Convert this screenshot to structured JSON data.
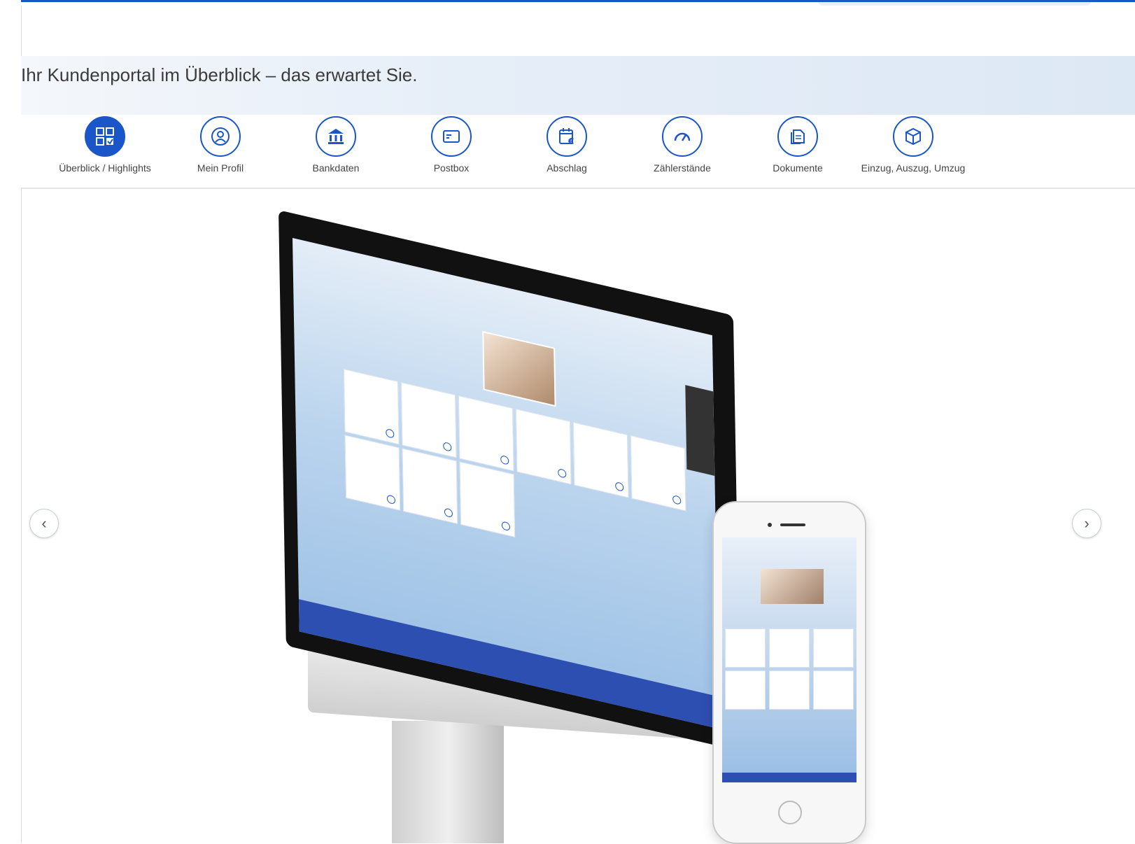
{
  "banner": {
    "title": "Ihr Kundenportal im Überblick – das erwartet Sie."
  },
  "nav": {
    "active_index": 0,
    "items": [
      {
        "label": "Überblick / Highlights",
        "icon": "overview-grid-icon"
      },
      {
        "label": "Mein Profil",
        "icon": "user-profile-icon"
      },
      {
        "label": "Bankdaten",
        "icon": "bank-icon"
      },
      {
        "label": "Postbox",
        "icon": "mailbox-icon"
      },
      {
        "label": "Abschlag",
        "icon": "calendar-euro-icon"
      },
      {
        "label": "Zählerstände",
        "icon": "gauge-icon"
      },
      {
        "label": "Dokumente",
        "icon": "documents-icon"
      },
      {
        "label": "Einzug, Auszug, Umzug",
        "icon": "move-box-icon"
      }
    ]
  },
  "carousel": {
    "prev_icon": "chevron-left-icon",
    "next_icon": "chevron-right-icon",
    "prev_symbol": "‹",
    "next_symbol": "›"
  },
  "colors": {
    "accent": "#1a56c8",
    "screen_footer": "#2d4fb1"
  }
}
